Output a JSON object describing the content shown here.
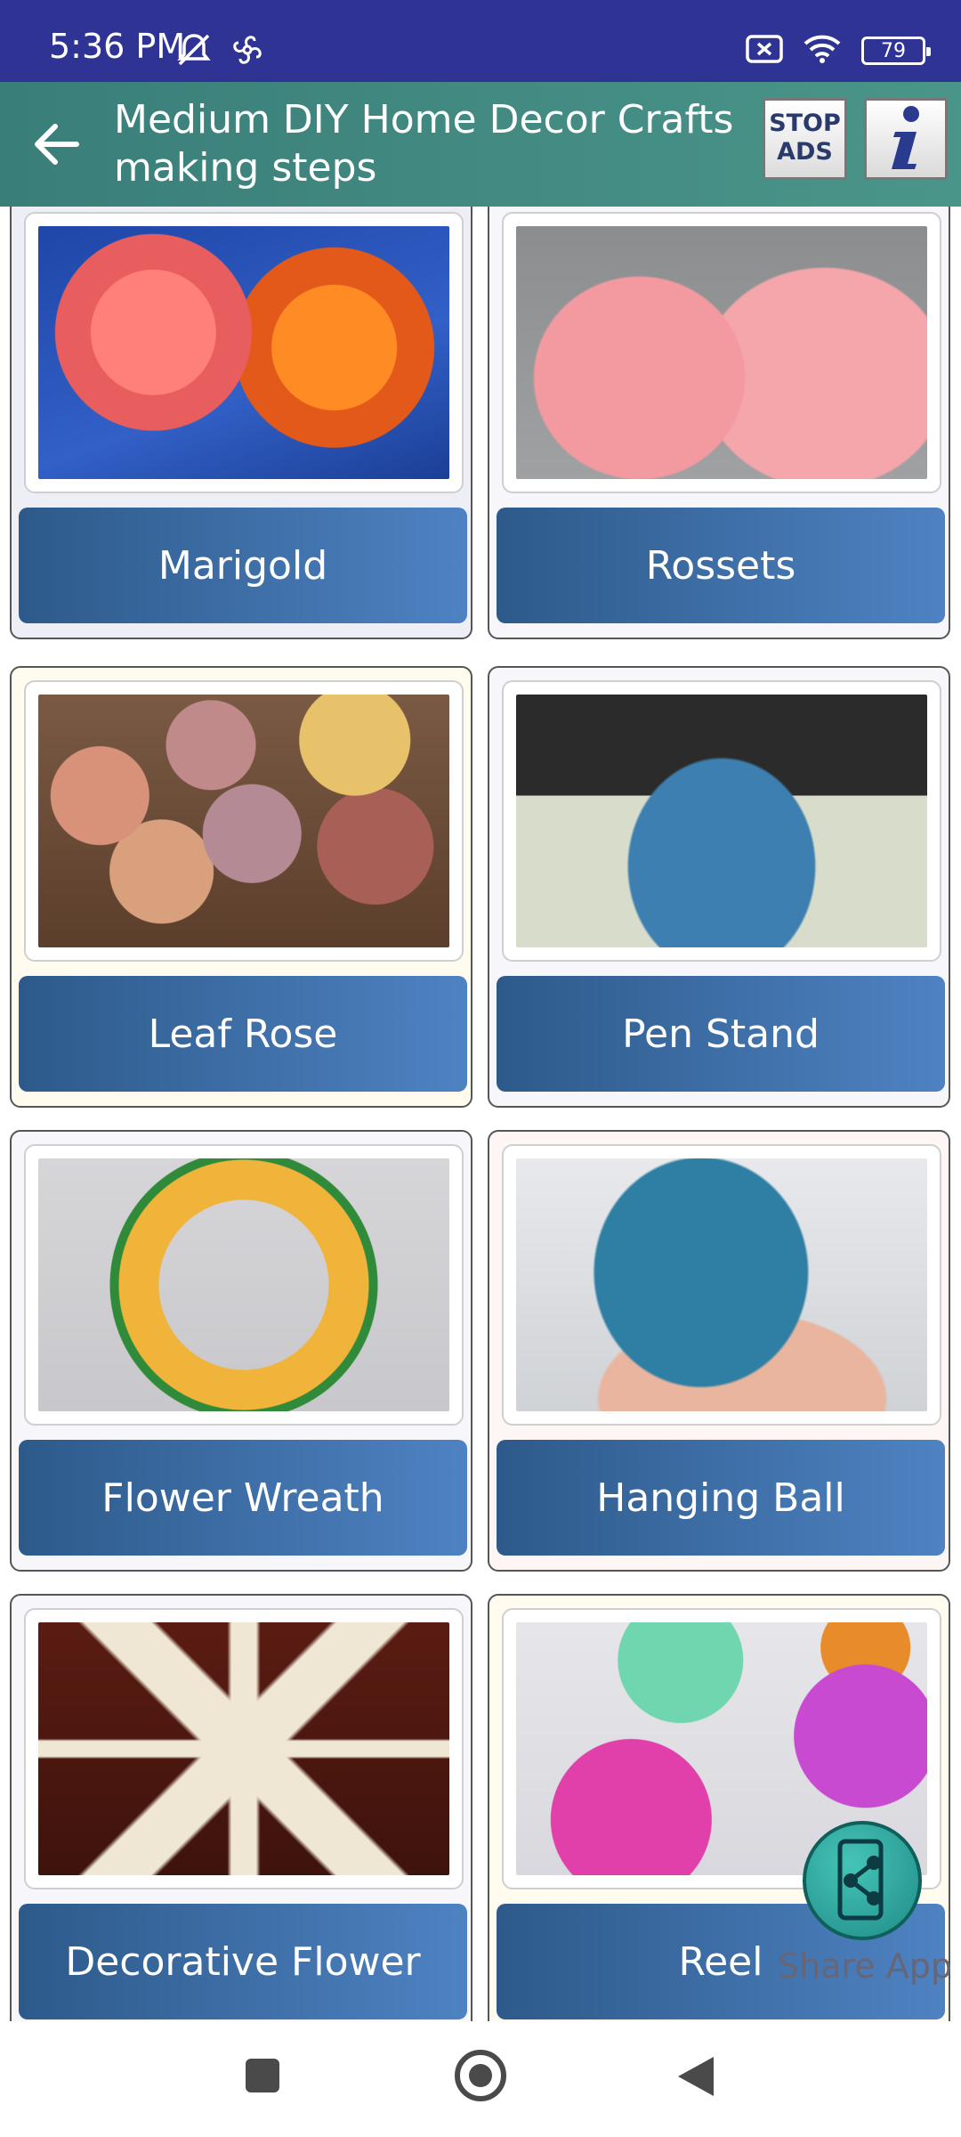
{
  "status_bar": {
    "time": "5:36 PM",
    "battery_level": "79",
    "icons": [
      "mute-icon",
      "pinwheel-icon",
      "sim-error-icon",
      "wifi-icon",
      "battery-icon"
    ]
  },
  "app_bar": {
    "title": "Medium DIY Home Decor Crafts making steps",
    "stop_ads_label": "STOP ADS"
  },
  "cards": [
    {
      "label": "Marigold",
      "image": "marigold-photo"
    },
    {
      "label": "Rossets",
      "image": "rossets-photo"
    },
    {
      "label": "Leaf Rose",
      "image": "leaf-rose-photo"
    },
    {
      "label": "Pen Stand",
      "image": "pen-stand-photo"
    },
    {
      "label": "Flower Wreath",
      "image": "flower-wreath-photo"
    },
    {
      "label": "Hanging Ball",
      "image": "hanging-ball-photo"
    },
    {
      "label": "Decorative Flower",
      "image": "decorative-flower-photo"
    },
    {
      "label": "Reel",
      "image": "reel-photo"
    }
  ],
  "share": {
    "label": "Share App"
  },
  "colors": {
    "status_bar": "#2f3494",
    "app_bar": "#3a7e79",
    "card_button": "#3a6ea5"
  }
}
